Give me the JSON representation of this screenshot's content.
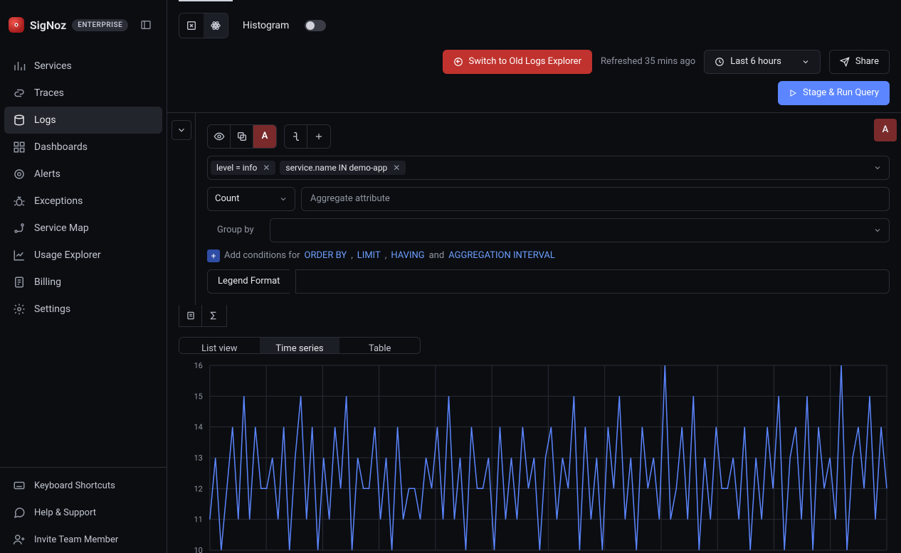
{
  "brand": {
    "name": "SigNoz",
    "plan": "ENTERPRISE"
  },
  "sidebar": {
    "items": [
      {
        "key": "services",
        "label": "Services",
        "icon": "bars"
      },
      {
        "key": "traces",
        "label": "Traces",
        "icon": "link"
      },
      {
        "key": "logs",
        "label": "Logs",
        "icon": "logs",
        "active": true
      },
      {
        "key": "dashboards",
        "label": "Dashboards",
        "icon": "grid"
      },
      {
        "key": "alerts",
        "label": "Alerts",
        "icon": "alert"
      },
      {
        "key": "exceptions",
        "label": "Exceptions",
        "icon": "bug"
      },
      {
        "key": "service-map",
        "label": "Service Map",
        "icon": "route"
      },
      {
        "key": "usage-explorer",
        "label": "Usage Explorer",
        "icon": "chart"
      },
      {
        "key": "billing",
        "label": "Billing",
        "icon": "receipt"
      },
      {
        "key": "settings",
        "label": "Settings",
        "icon": "gear"
      }
    ],
    "footer": [
      {
        "key": "keyboard",
        "label": "Keyboard Shortcuts",
        "icon": "keyboard"
      },
      {
        "key": "help",
        "label": "Help & Support",
        "icon": "chat"
      },
      {
        "key": "invite",
        "label": "Invite Team Member",
        "icon": "userplus"
      }
    ]
  },
  "header": {
    "histogram_label": "Histogram",
    "histogram_on": false,
    "switch_old": "Switch to Old Logs Explorer",
    "refreshed": "Refreshed 35 mins ago",
    "timerange": "Last 6 hours",
    "share": "Share",
    "run": "Stage & Run Query",
    "query_letter": "A"
  },
  "query": {
    "filters": [
      {
        "text": "level = info"
      },
      {
        "text": "service.name IN demo-app"
      }
    ],
    "agg": "Count",
    "agg_attr_placeholder": "Aggregate attribute",
    "group_by_label": "Group by",
    "conditions": {
      "prefix": "Add conditions for ",
      "links": [
        "ORDER BY",
        "LIMIT",
        "HAVING",
        "AGGREGATION INTERVAL"
      ],
      "seps": [
        ", ",
        ", ",
        " and ",
        ""
      ]
    },
    "legend_label": "Legend Format"
  },
  "view_tabs": {
    "list": "List view",
    "series": "Time series",
    "table": "Table",
    "active": "series"
  },
  "chart_data": {
    "type": "line",
    "title": "",
    "xlabel": "",
    "ylabel": "",
    "ylim": [
      10,
      16
    ],
    "yticks": [
      10,
      11,
      12,
      13,
      14,
      15,
      16
    ],
    "x": [
      0,
      1,
      2,
      3,
      4,
      5,
      6,
      7,
      8,
      9,
      10,
      11,
      12,
      13,
      14,
      15,
      16,
      17,
      18,
      19,
      20,
      21,
      22,
      23,
      24,
      25,
      26,
      27,
      28,
      29,
      30,
      31,
      32,
      33,
      34,
      35,
      36,
      37,
      38,
      39,
      40,
      41,
      42,
      43,
      44,
      45,
      46,
      47,
      48,
      49,
      50,
      51,
      52,
      53,
      54,
      55,
      56,
      57,
      58,
      59,
      60,
      61,
      62,
      63,
      64,
      65,
      66,
      67,
      68,
      69,
      70,
      71,
      72,
      73,
      74,
      75,
      76,
      77,
      78,
      79,
      80,
      81,
      82,
      83,
      84,
      85,
      86,
      87,
      88,
      89,
      90,
      91,
      92,
      93,
      94,
      95,
      96,
      97,
      98,
      99,
      100,
      101,
      102,
      103,
      104,
      105,
      106,
      107,
      108,
      109,
      110,
      111,
      112,
      113,
      114,
      115,
      116,
      117,
      118,
      119
    ],
    "values": [
      11,
      13,
      10,
      12,
      14,
      11,
      15,
      11,
      14,
      12,
      12,
      13,
      11,
      14,
      10,
      13,
      15,
      11,
      14,
      10,
      13,
      11,
      14,
      12,
      15,
      10,
      13,
      12,
      12,
      14,
      11,
      13,
      10,
      14,
      11,
      12,
      12,
      11,
      13,
      12,
      14,
      11,
      15,
      11,
      13,
      10,
      14,
      12,
      12,
      13,
      10,
      14,
      11,
      13,
      11,
      14,
      12,
      13,
      10,
      13,
      14,
      11,
      13,
      12,
      15,
      10,
      14,
      11,
      13,
      10,
      14,
      12,
      15,
      11,
      13,
      10,
      14,
      12,
      13,
      11,
      16,
      11,
      12,
      14,
      11,
      15,
      10,
      13,
      11,
      14,
      12,
      12,
      13,
      11,
      14,
      10,
      13,
      11,
      14,
      12,
      15,
      10,
      13,
      14,
      11,
      15,
      10,
      14,
      12,
      13,
      11,
      16,
      10,
      13,
      14,
      12,
      15,
      11,
      14,
      12
    ],
    "series_color": "#5c86ff"
  }
}
